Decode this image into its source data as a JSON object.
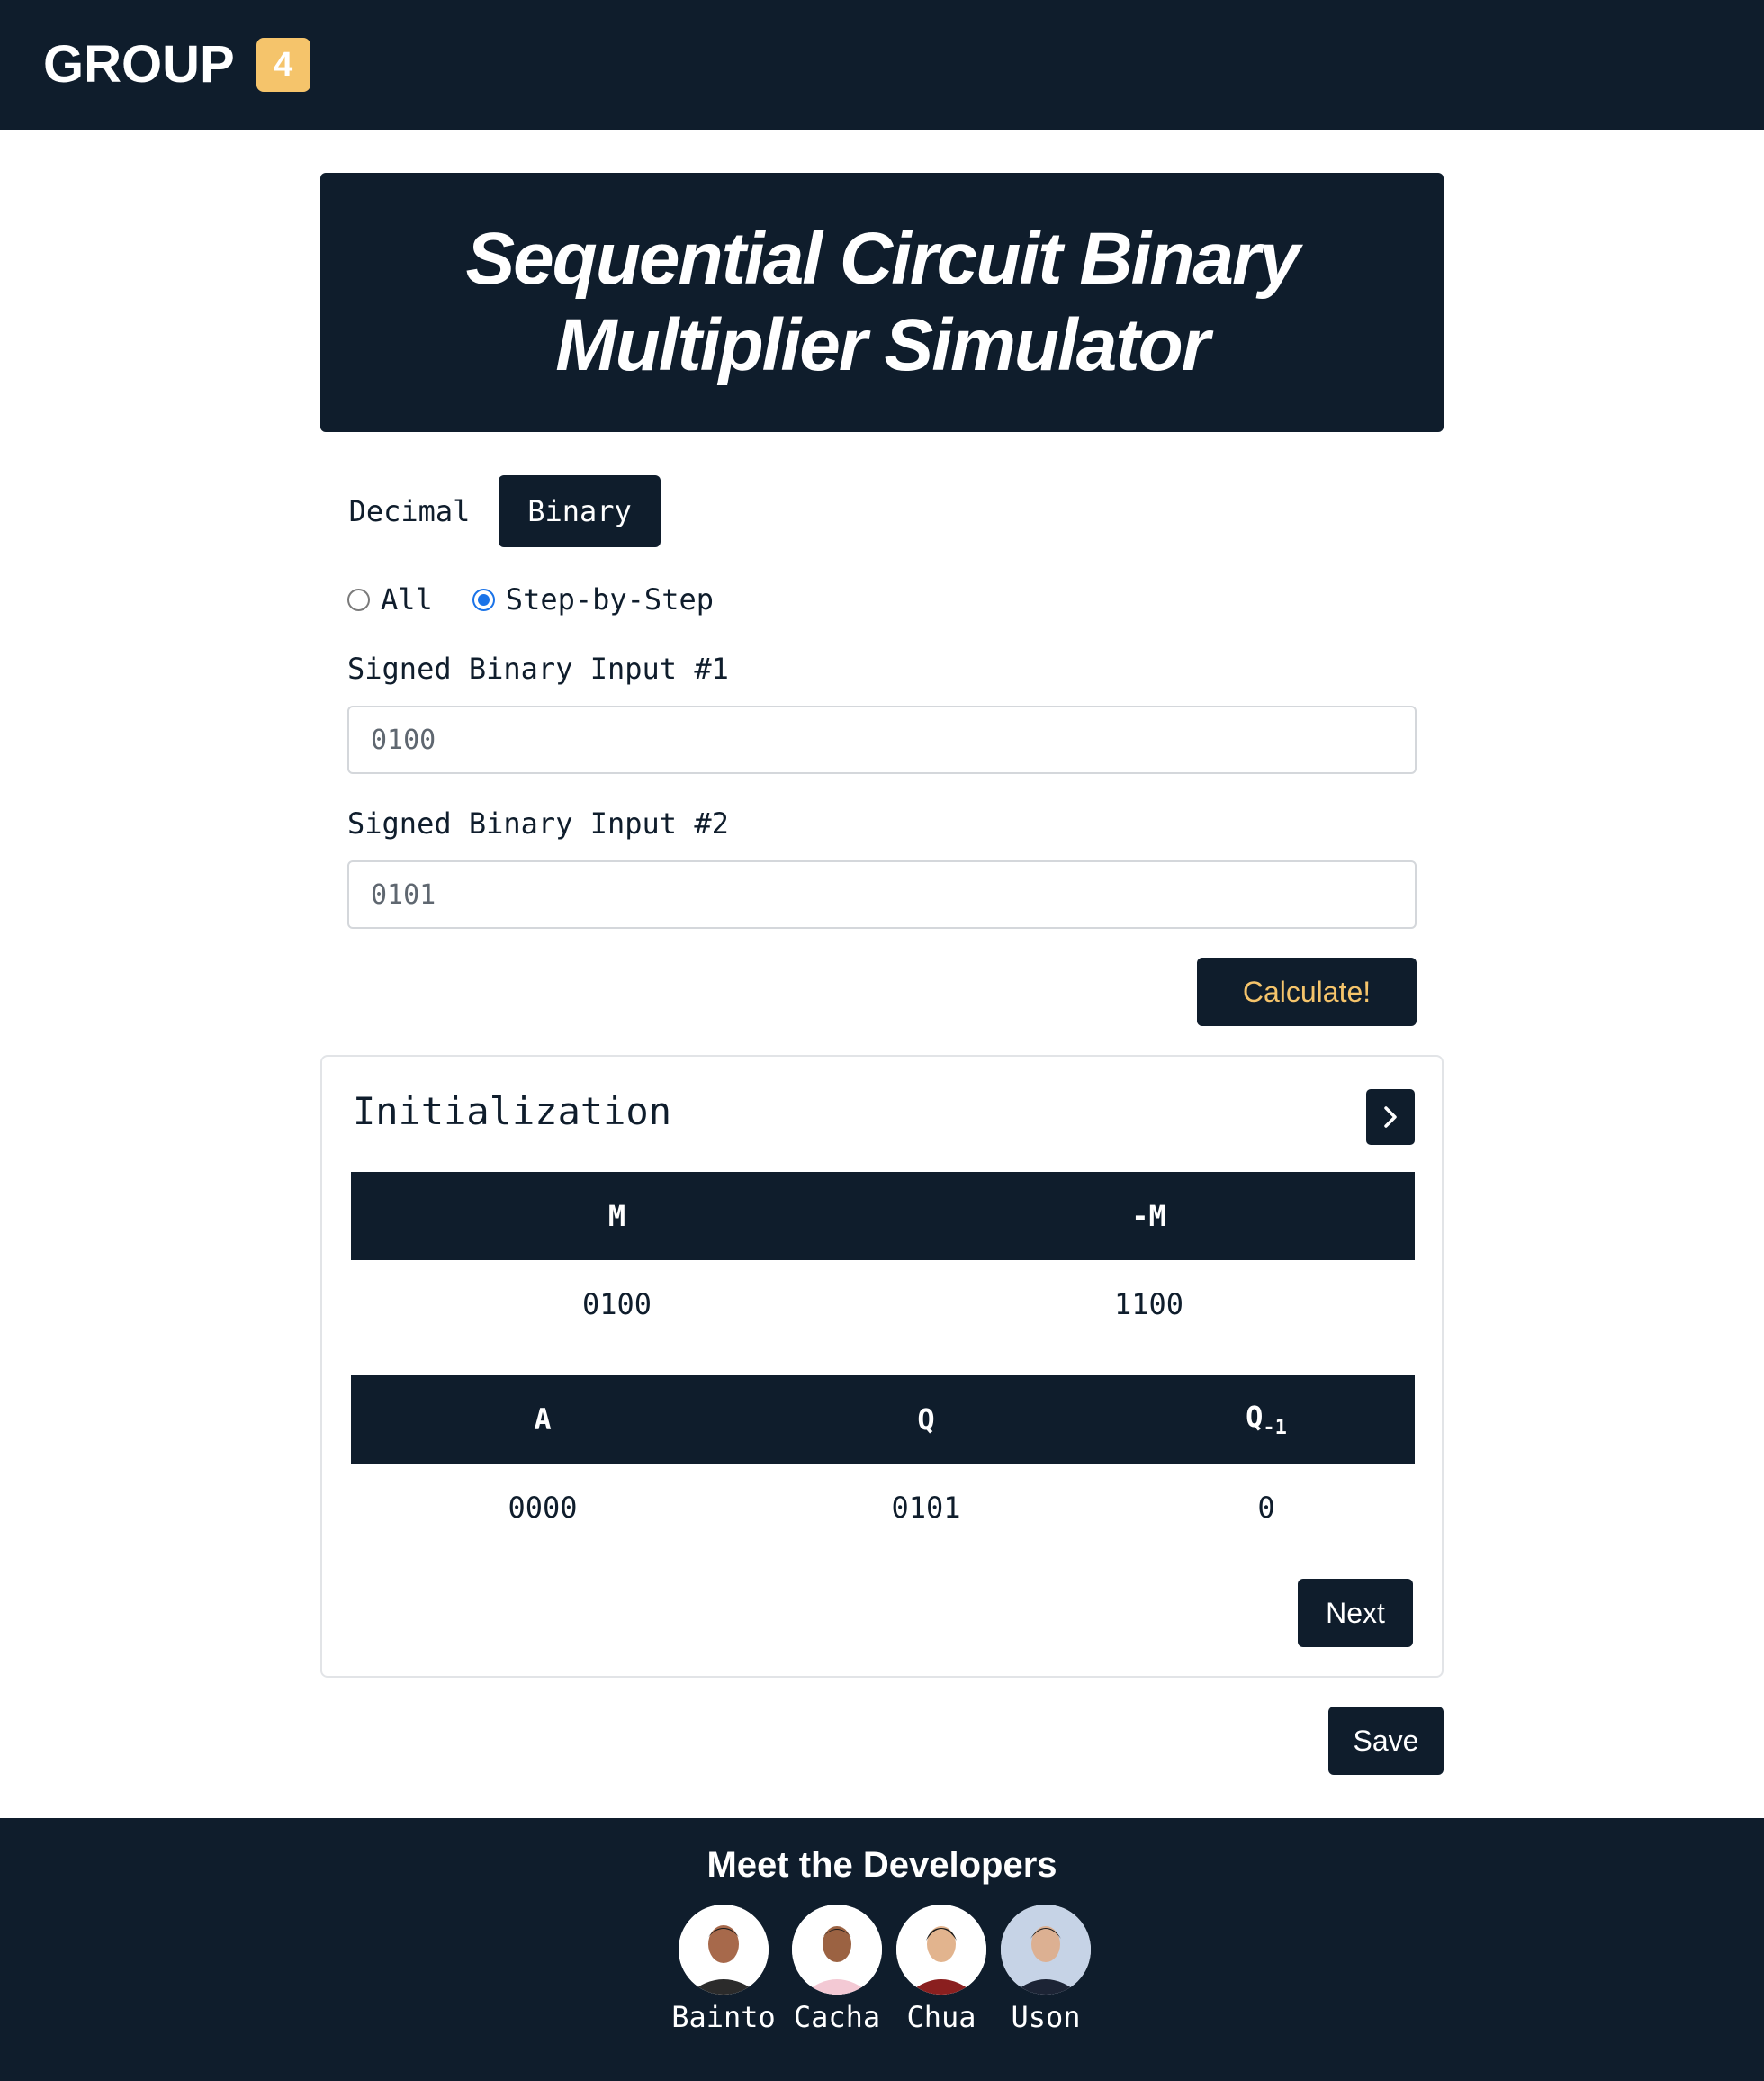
{
  "brand": {
    "text": "GROUP",
    "badge": "4"
  },
  "hero": {
    "title": "Sequential Circuit Binary Multiplier Simulator"
  },
  "mode_tabs": [
    {
      "label": "Decimal",
      "active": false
    },
    {
      "label": "Binary",
      "active": true
    }
  ],
  "display_mode": {
    "options": [
      {
        "label": "All",
        "checked": false
      },
      {
        "label": "Step-by-Step",
        "checked": true
      }
    ]
  },
  "inputs": {
    "input1": {
      "label": "Signed Binary Input #1",
      "value": "0100"
    },
    "input2": {
      "label": "Signed Binary Input #2",
      "value": "0101"
    }
  },
  "calculate_label": "Calculate!",
  "step_card": {
    "title": "Initialization",
    "table1": {
      "headers": [
        "M",
        "-M"
      ],
      "row": [
        "0100",
        "1100"
      ]
    },
    "table2": {
      "headers": [
        "A",
        "Q",
        "Q",
        "-1"
      ],
      "row": [
        "0000",
        "0101",
        "0"
      ]
    },
    "next_label": "Next"
  },
  "save_label": "Save",
  "footer": {
    "title": "Meet the Developers",
    "developers": [
      {
        "name": "Bainto"
      },
      {
        "name": "Cacha"
      },
      {
        "name": "Chua"
      },
      {
        "name": "Uson"
      }
    ]
  },
  "colors": {
    "navy": "#0f1d2c",
    "accent": "#f5c46b",
    "radio": "#1a73e8"
  }
}
